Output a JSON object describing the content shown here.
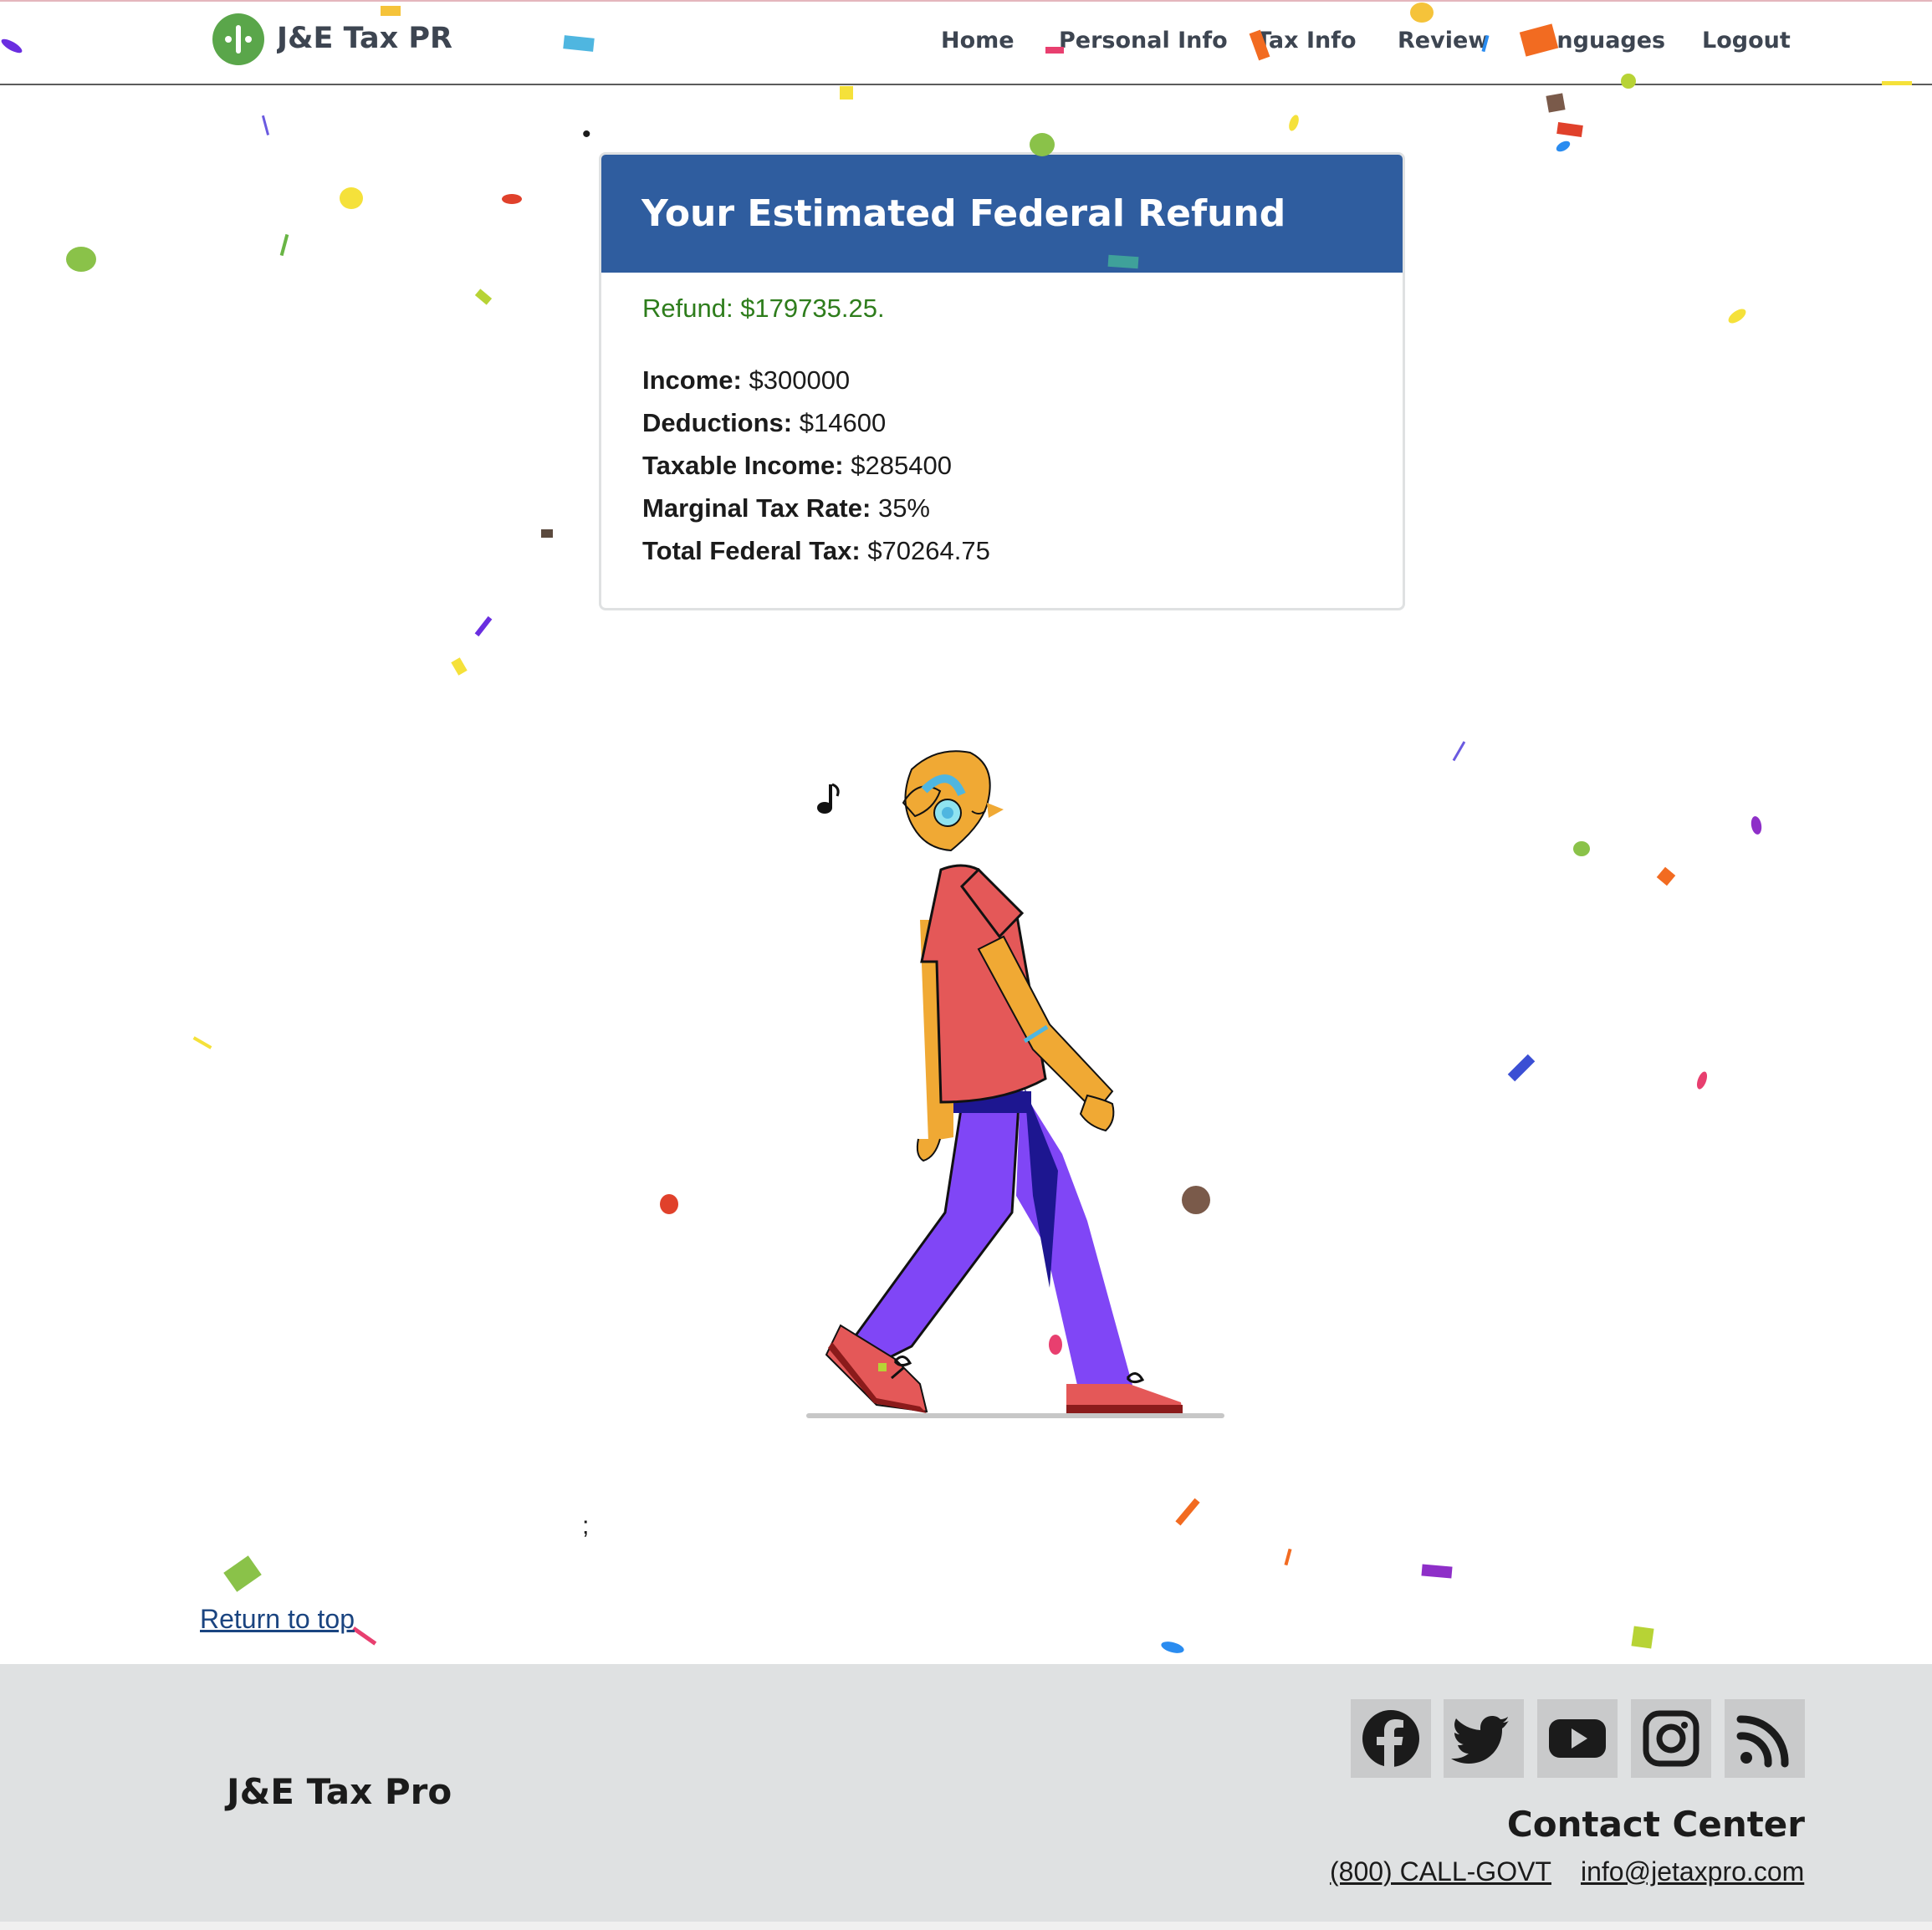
{
  "header": {
    "brand": "J&E Tax PRO",
    "nav": [
      "Home",
      "Personal Info",
      "Tax Info",
      "Review",
      "Languages",
      "Logout"
    ]
  },
  "card": {
    "title": "Your Estimated Federal Refund",
    "refund": "Refund: $179735.25.",
    "rows": [
      {
        "label": "Income:",
        "value": "$300000"
      },
      {
        "label": "Deductions:",
        "value": "$14600"
      },
      {
        "label": "Taxable Income:",
        "value": "$285400"
      },
      {
        "label": "Marginal Tax Rate:",
        "value": "35%"
      },
      {
        "label": "Total Federal Tax:",
        "value": "$70264.75"
      }
    ]
  },
  "stray": {
    "dot": "•",
    "semicolon": ";"
  },
  "return_link": "Return to top",
  "footer": {
    "brand": "J&E Tax Pro",
    "social_icons": [
      "facebook-icon",
      "twitter-icon",
      "youtube-icon",
      "instagram-icon",
      "rss-icon"
    ],
    "contact_title": "Contact Center",
    "phone": "(800) CALL-GOVT",
    "email": "info@jetaxpro.com"
  },
  "colors": {
    "header_bar": "#2f5d9f",
    "refund_text": "#2e7d1c",
    "link": "#1a4480",
    "footer_bg": "#dfe1e2",
    "logo_green": "#5aa64a"
  }
}
